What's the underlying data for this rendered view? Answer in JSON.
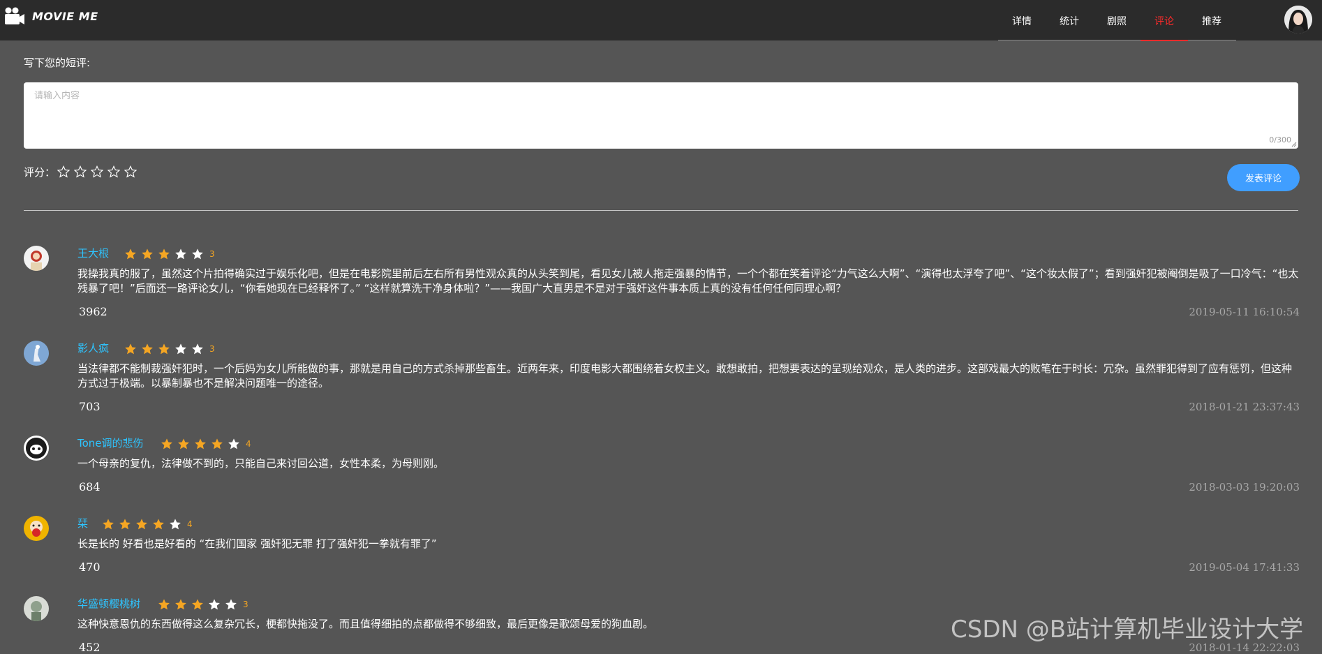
{
  "header": {
    "brand": "MOVIE ME",
    "nav": [
      {
        "label": "详情",
        "active": false
      },
      {
        "label": "统计",
        "active": false
      },
      {
        "label": "剧照",
        "active": false
      },
      {
        "label": "评论",
        "active": true
      },
      {
        "label": "推荐",
        "active": false
      }
    ]
  },
  "form": {
    "label": "写下您的短评:",
    "placeholder": "请输入内容",
    "value": "",
    "char_count": "0/300",
    "rating_label": "评分：",
    "rating_value": 0,
    "rating_max": 5,
    "submit_label": "发表评论"
  },
  "comments": [
    {
      "user": "王大根",
      "rating": 3,
      "text": "我操我真的服了，虽然这个片拍得确实过于娱乐化吧，但是在电影院里前后左右所有男性观众真的从头笑到尾，看见女儿被人拖走强暴的情节，一个个都在笑着评论“力气这么大啊”、“演得也太浮夸了吧”、“这个妆太假了”；看到强奸犯被阉倒是吸了一口冷气：“也太残暴了吧！”后面还一路评论女儿，“你看她现在已经释怀了。” “这样就算洗干净身体啦？”——我国广大直男是不是对于强奸这件事本质上真的没有任何任何同理心啊？",
      "likes": "3962",
      "date": "2019-05-11 16:10:54"
    },
    {
      "user": "影人疯",
      "rating": 3,
      "text": "当法律都不能制裁强奸犯时，一个后妈为女儿所能做的事，那就是用自己的方式杀掉那些畜生。近两年来，印度电影大都围绕着女权主义。敢想敢拍，把想要表达的呈现给观众，是人类的进步。这部戏最大的败笔在于时长：冗杂。虽然罪犯得到了应有惩罚，但这种方式过于极端。以暴制暴也不是解决问题唯一的途径。",
      "likes": "703",
      "date": "2018-01-21 23:37:43"
    },
    {
      "user": "Tone调的悲伤",
      "rating": 4,
      "text": "一个母亲的复仇，法律做不到的，只能自己来讨回公道，女性本柔，为母则刚。",
      "likes": "684",
      "date": "2018-03-03 19:20:03"
    },
    {
      "user": "栞",
      "rating": 4,
      "text": "长是长的 好看也是好看的 “在我们国家 强奸犯无罪 打了强奸犯一拳就有罪了”",
      "likes": "470",
      "date": "2019-05-04 17:41:33"
    },
    {
      "user": "华盛顿樱桃树",
      "rating": 3,
      "text": "这种快意恩仇的东西做得这么复杂冗长，梗都快拖没了。而且值得细拍的点都做得不够细致，最后更像是歌颂母爱的狗血剧。",
      "likes": "452",
      "date": "2018-01-14 22:22:03"
    }
  ],
  "watermark": "CSDN @B站计算机毕业设计大学",
  "colors": {
    "background": "#555555",
    "header": "#2b2b2b",
    "active_tab": "#ff2b2b",
    "username": "#2ec4ff",
    "star_filled": "#f5a623",
    "button": "#409eff"
  }
}
